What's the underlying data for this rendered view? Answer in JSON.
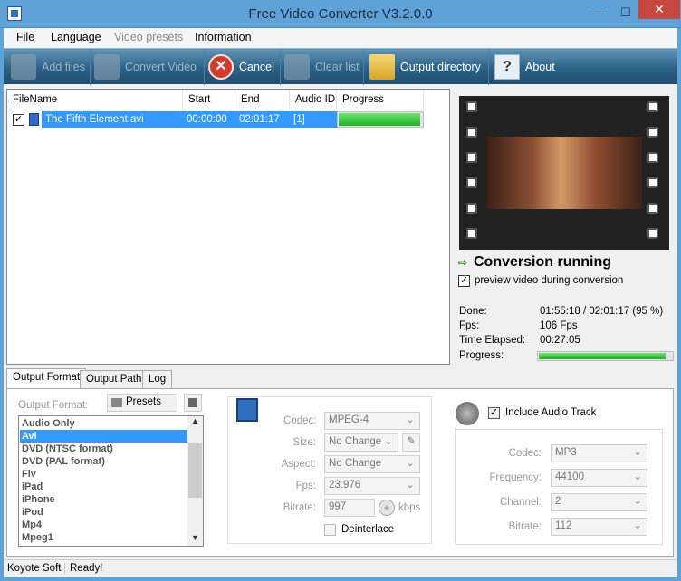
{
  "window": {
    "title": "Free Video Converter V3.2.0.0",
    "min": "—",
    "max": "☐",
    "close": "✕"
  },
  "menu": [
    "File",
    "Language",
    "Video presets",
    "Information"
  ],
  "toolbar": {
    "add_files": "Add files",
    "convert": "Convert Video",
    "cancel": "Cancel",
    "clear": "Clear list",
    "output_dir": "Output directory",
    "about": "About"
  },
  "filelist": {
    "headers": [
      "FileName",
      "Start",
      "End",
      "Audio ID",
      "Progress"
    ],
    "row": {
      "name": "The Fifth Element.avi",
      "start": "00:00:00",
      "end": "02:01:17",
      "audio": "[1]",
      "progress": 0.98,
      "checked": "✓"
    }
  },
  "status": {
    "title": "Conversion running",
    "arrow": "⇨",
    "preview_check": "✓",
    "preview_label": "preview video during conversion",
    "done_label": "Done:",
    "done_value": "01:55:18 / 02:01:17  (95 %)",
    "fps_label": "Fps:",
    "fps_value": "106 Fps",
    "elapsed_label": "Time Elapsed:",
    "elapsed_value": "00:27:05",
    "progress_label": "Progress:",
    "progress": 0.95
  },
  "tabs": [
    "Output Format",
    "Output Path",
    "Log"
  ],
  "output": {
    "format_label": "Output Format:",
    "presets": "Presets",
    "formats": [
      "Audio Only",
      "Avi",
      "DVD (NTSC format)",
      "DVD (PAL format)",
      "Flv",
      "iPad",
      "iPhone",
      "iPod",
      "Mp4",
      "Mpeg1"
    ],
    "selected": "Avi"
  },
  "video": {
    "codec_label": "Codec:",
    "codec": "MPEG-4",
    "size_label": "Size:",
    "size": "No Change",
    "aspect_label": "Aspect:",
    "aspect": "No Change",
    "fps_label": "Fps:",
    "fps": "23.976",
    "bitrate_label": "Bitrate:",
    "bitrate": "997",
    "kbps": "kbps",
    "deinterlace": "Deinterlace"
  },
  "audio": {
    "include": "Include Audio Track",
    "include_check": "✓",
    "codec_label": "Codec:",
    "codec": "MP3",
    "freq_label": "Frequency:",
    "freq": "44100",
    "channel_label": "Channel:",
    "channel": "2",
    "bitrate_label": "Bitrate:",
    "bitrate": "112"
  },
  "statusbar": {
    "left": "Koyote Soft",
    "right": "Ready!"
  }
}
